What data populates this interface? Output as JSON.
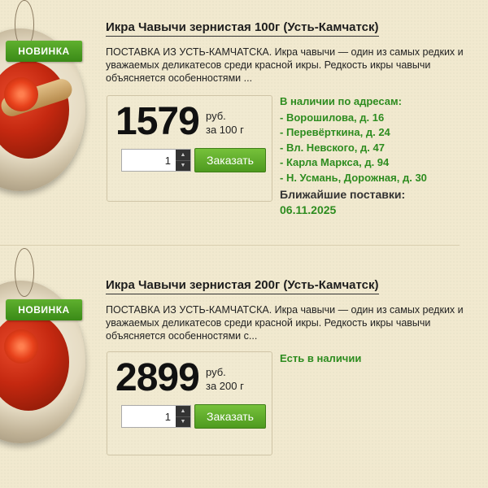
{
  "products": [
    {
      "badge": "НОВИНКА",
      "title": "Икра Чавычи зернистая 100г (Усть-Камчатск)",
      "description": "ПОСТАВКА ИЗ УСТЬ-КАМЧАТСКА. Икра чавычи — один из самых редких и уважаемых деликатесов среди красной икры. Редкость икры чавычи объясняется особенностями ...",
      "price": "1579",
      "currency": "руб.",
      "per": "за 100 г",
      "quantity": "1",
      "order_label": "Заказать",
      "availability_title": "В наличии по адресам:",
      "addresses": [
        "- Ворошилова, д. 16",
        "- Перевёрткина, д. 24",
        "- Вл. Невского, д. 47",
        "- Карла Маркса, д. 94",
        "- Н. Усмань, Дорожная, д. 30"
      ],
      "delivery_title": "Ближайшие поставки:",
      "delivery_date": "06.11.2025"
    },
    {
      "badge": "НОВИНКА",
      "title": "Икра Чавычи зернистая 200г (Усть-Камчатск)",
      "description": "ПОСТАВКА ИЗ УСТЬ-КАМЧАТСКА. Икра чавычи — один из самых редких и уважаемых деликатесов среди красной икры. Редкость икры чавычи объясняется особенностями с...",
      "price": "2899",
      "currency": "руб.",
      "per": "за 200 г",
      "quantity": "1",
      "order_label": "Заказать",
      "availability_title": "Есть в наличии"
    }
  ],
  "colors": {
    "background": "#f1e9cf",
    "accent_green": "#2d8c1f",
    "button_green": "#5fa82a"
  },
  "icons": [
    "arrow-up-icon",
    "arrow-down-icon"
  ]
}
